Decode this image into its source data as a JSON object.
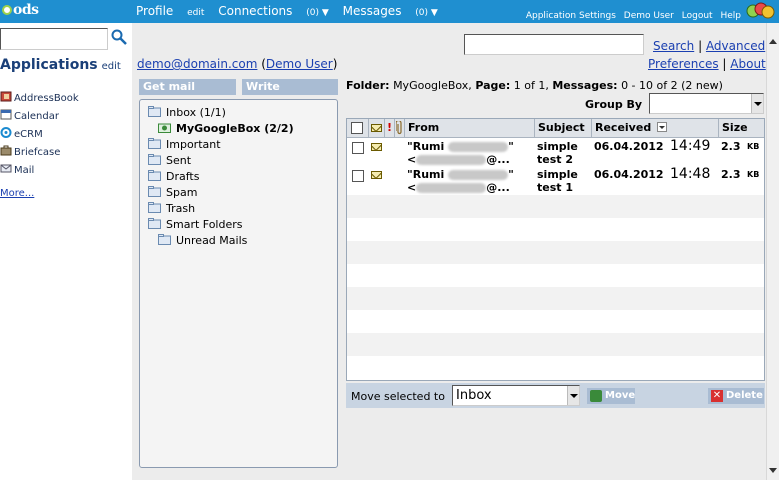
{
  "topbar": {
    "logo": "ods",
    "nav": [
      {
        "label": "Profile",
        "suffix": "edit"
      },
      {
        "label": "Connections",
        "suffix": "(0) ▼"
      },
      {
        "label": "Messages",
        "suffix": "(0) ▼"
      }
    ],
    "links": [
      "Application Settings",
      "Demo User",
      "Logout",
      "Help"
    ]
  },
  "sidebar": {
    "search_value": "",
    "applications_title": "Applications",
    "applications_edit": "edit",
    "apps": [
      "AddressBook",
      "Calendar",
      "eCRM",
      "Briefcase",
      "Mail"
    ],
    "more": "More..."
  },
  "header": {
    "search_value": "",
    "search_link": "Search",
    "separator": "|",
    "advanced_link": "Advanced",
    "preferences_link": "Preferences",
    "about_link": "About",
    "user_email": "demo@domain.com",
    "user_name": "Demo User"
  },
  "actions": {
    "get_mail": "Get mail",
    "write": "Write"
  },
  "folders": [
    {
      "label": "Inbox (1/1)",
      "indent": 0,
      "bold": false
    },
    {
      "label": "MyGoogleBox (2/2)",
      "indent": 1,
      "bold": true
    },
    {
      "label": "Important",
      "indent": 0,
      "bold": false
    },
    {
      "label": "Sent",
      "indent": 0,
      "bold": false
    },
    {
      "label": "Drafts",
      "indent": 0,
      "bold": false
    },
    {
      "label": "Spam",
      "indent": 0,
      "bold": false
    },
    {
      "label": "Trash",
      "indent": 0,
      "bold": false
    },
    {
      "label": "Smart Folders",
      "indent": 0,
      "bold": false
    },
    {
      "label": "Unread Mails",
      "indent": 1,
      "bold": false
    }
  ],
  "folder_info": {
    "folder_label": "Folder:",
    "folder_name": "MyGoogleBox,",
    "page_label": "Page:",
    "page_value": "1 of 1,",
    "messages_label": "Messages:",
    "messages_value": "0 - 10 of 2 (2 new)",
    "group_by_label": "Group By",
    "group_by_value": ""
  },
  "table": {
    "columns": {
      "priority": "!",
      "from": "From",
      "subject": "Subject",
      "received": "Received",
      "size": "Size"
    },
    "rows": [
      {
        "from_line1": "\"Rumi",
        "from_line1_end": "\"",
        "from_line2": "<",
        "from_line2_end": "@...",
        "subject_line1": "simple",
        "subject_line2": "test 2",
        "date": "06.04.2012",
        "time": "14:49",
        "size": "2.3",
        "unit": "KB"
      },
      {
        "from_line1": "\"Rumi",
        "from_line1_end": "\"",
        "from_line2": "<",
        "from_line2_end": "@...",
        "subject_line1": "simple",
        "subject_line2": "test 1",
        "date": "06.04.2012",
        "time": "14:48",
        "size": "2.3",
        "unit": "KB"
      }
    ]
  },
  "movebar": {
    "label": "Move selected to",
    "selected": "Inbox",
    "move": "Move",
    "delete": "Delete"
  },
  "colors": {
    "topbar": "#1f8fd0",
    "button": "#a9bcd3",
    "link": "#1a3fb0",
    "heading": "#1a3f78"
  }
}
